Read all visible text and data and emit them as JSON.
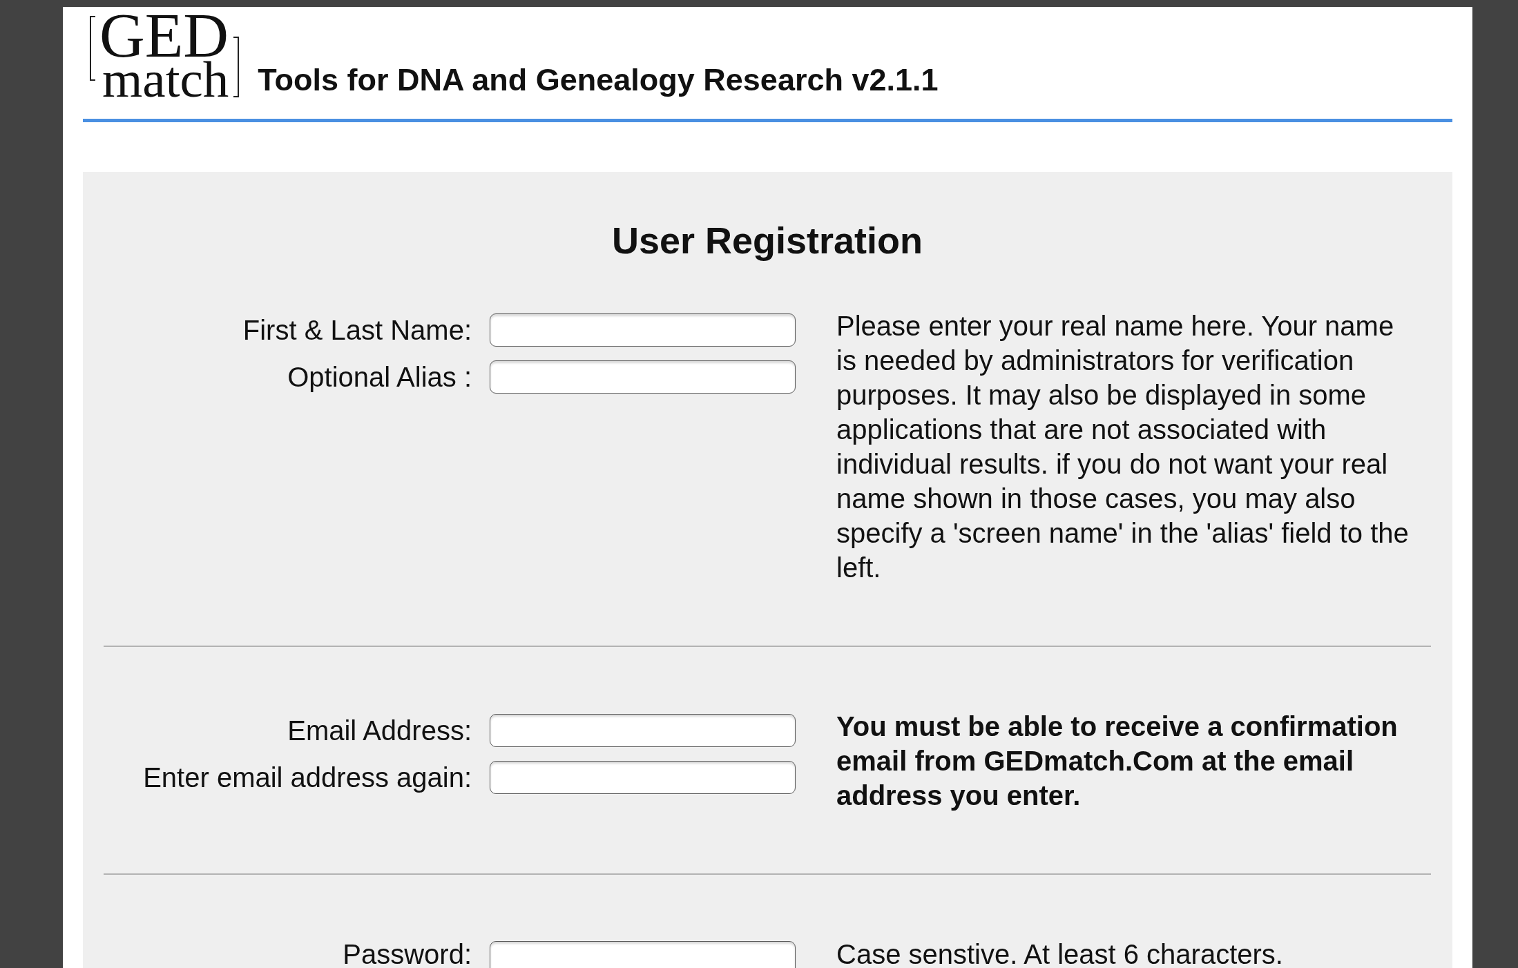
{
  "header": {
    "logo": {
      "line_1": "GED",
      "line_2": "match"
    },
    "title": "Tools for DNA and Genealogy Research v2.1.1"
  },
  "form": {
    "title": "User Registration",
    "sections": [
      {
        "fields": [
          {
            "label": "First & Last Name:"
          },
          {
            "label": "Optional Alias :"
          }
        ],
        "help": {
          "text": "Please enter your real name here. Your name is needed by administrators for verification purposes. It may also be displayed in some applications that are not associated with individual results. if you do not want your real name shown in those cases, you may also specify a 'screen name' in the 'alias' field to the left.",
          "emphasized": false
        }
      },
      {
        "fields": [
          {
            "label": "Email Address:"
          },
          {
            "label": "Enter email address again:"
          }
        ],
        "help": {
          "text": "You must be able to receive a confirmation email from GEDmatch.Com at the email address you enter.",
          "emphasized": true
        }
      },
      {
        "fields": [
          {
            "label": "Password:"
          }
        ],
        "help": {
          "text": "Case senstive. At least 6 characters.",
          "emphasized": false
        }
      }
    ]
  }
}
